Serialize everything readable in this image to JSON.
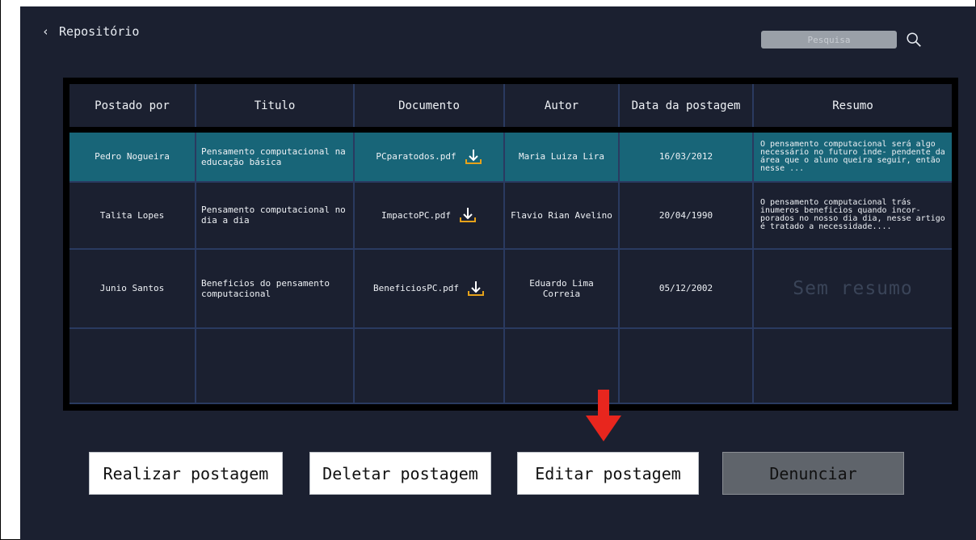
{
  "header": {
    "back_label": "Repositório",
    "search_placeholder": "Pesquisa"
  },
  "table": {
    "columns": [
      "Postado por",
      "Titulo",
      "Documento",
      "Autor",
      "Data da postagem",
      "Resumo"
    ],
    "rows": [
      {
        "postado_por": "Pedro Nogueira",
        "titulo": "Pensamento computacional na educação básica",
        "documento": "PCparatodos.pdf",
        "autor": "Maria Luiza Lira",
        "data": "16/03/2012",
        "resumo": "O pensamento computacional será algo necessário no futuro inde- pendente da área que o aluno queira seguir, então nesse ..."
      },
      {
        "postado_por": "Talita Lopes",
        "titulo": "Pensamento computacional no dia a dia",
        "documento": "ImpactoPC.pdf",
        "autor": "Flavio Rian Avelino",
        "data": "20/04/1990",
        "resumo": "O pensamento computacional trás inumeros beneficios quando incor- porados no nosso dia dia, nesse artigo é tratado a necessidade...."
      },
      {
        "postado_por": "Junio Santos",
        "titulo": "Beneficios do pensamento computacional",
        "documento": "BeneficiosPC.pdf",
        "autor": "Eduardo Lima Correia",
        "data": "05/12/2002",
        "resumo": "Sem resumo"
      }
    ]
  },
  "buttons": {
    "realizar": "Realizar postagem",
    "deletar": "Deletar postagem",
    "editar": "Editar postagem",
    "denunciar": "Denunciar"
  },
  "colors": {
    "background": "#1b2030",
    "selected_row": "#186578",
    "arrow": "#e8261e",
    "denunciar_bg": "#5f646b"
  },
  "icons": [
    "chevron-left-icon",
    "search-icon",
    "download-icon",
    "arrow-down-icon"
  ]
}
